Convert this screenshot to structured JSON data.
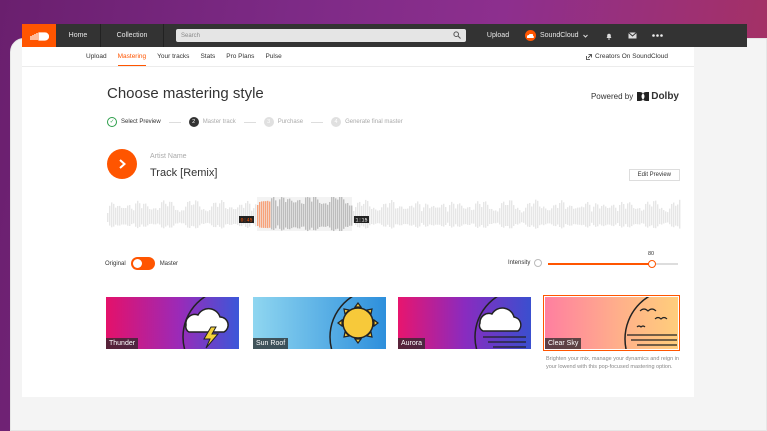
{
  "header": {
    "nav": [
      "Home",
      "Collection"
    ],
    "search_placeholder": "Search",
    "upload": "Upload",
    "account": "SoundCloud",
    "icons": [
      "bell-icon",
      "mail-icon",
      "more-icon"
    ]
  },
  "subnav": {
    "items": [
      "Upload",
      "Mastering",
      "Your tracks",
      "Stats",
      "Pro Plans",
      "Pulse"
    ],
    "active": "Mastering",
    "creators": "Creators On SoundCloud"
  },
  "page": {
    "title": "Choose mastering style",
    "powered_by": "Powered by",
    "brand": "Dolby"
  },
  "steps": [
    "Select Preview",
    "Master track",
    "Purchase",
    "Generate final master"
  ],
  "step_numbers": [
    "2",
    "3",
    "4"
  ],
  "track": {
    "artist": "Artist Name",
    "name": "Track [Remix]",
    "edit_preview": "Edit Preview",
    "start_time": "0:45",
    "end_time": "1:15"
  },
  "controls": {
    "original": "Original",
    "master": "Master",
    "intensity_label": "Intensity",
    "intensity_value": 80
  },
  "styles": [
    {
      "name": "Thunder"
    },
    {
      "name": "Sun Roof"
    },
    {
      "name": "Aurora"
    },
    {
      "name": "Clear Sky"
    }
  ],
  "selected_style": "Clear Sky",
  "style_description": "Brighten your mix, manage your dynamics and reign in your lowend with this pop-focused mastering option.",
  "colors": {
    "accent": "#ff5500",
    "topbar": "#333333"
  }
}
